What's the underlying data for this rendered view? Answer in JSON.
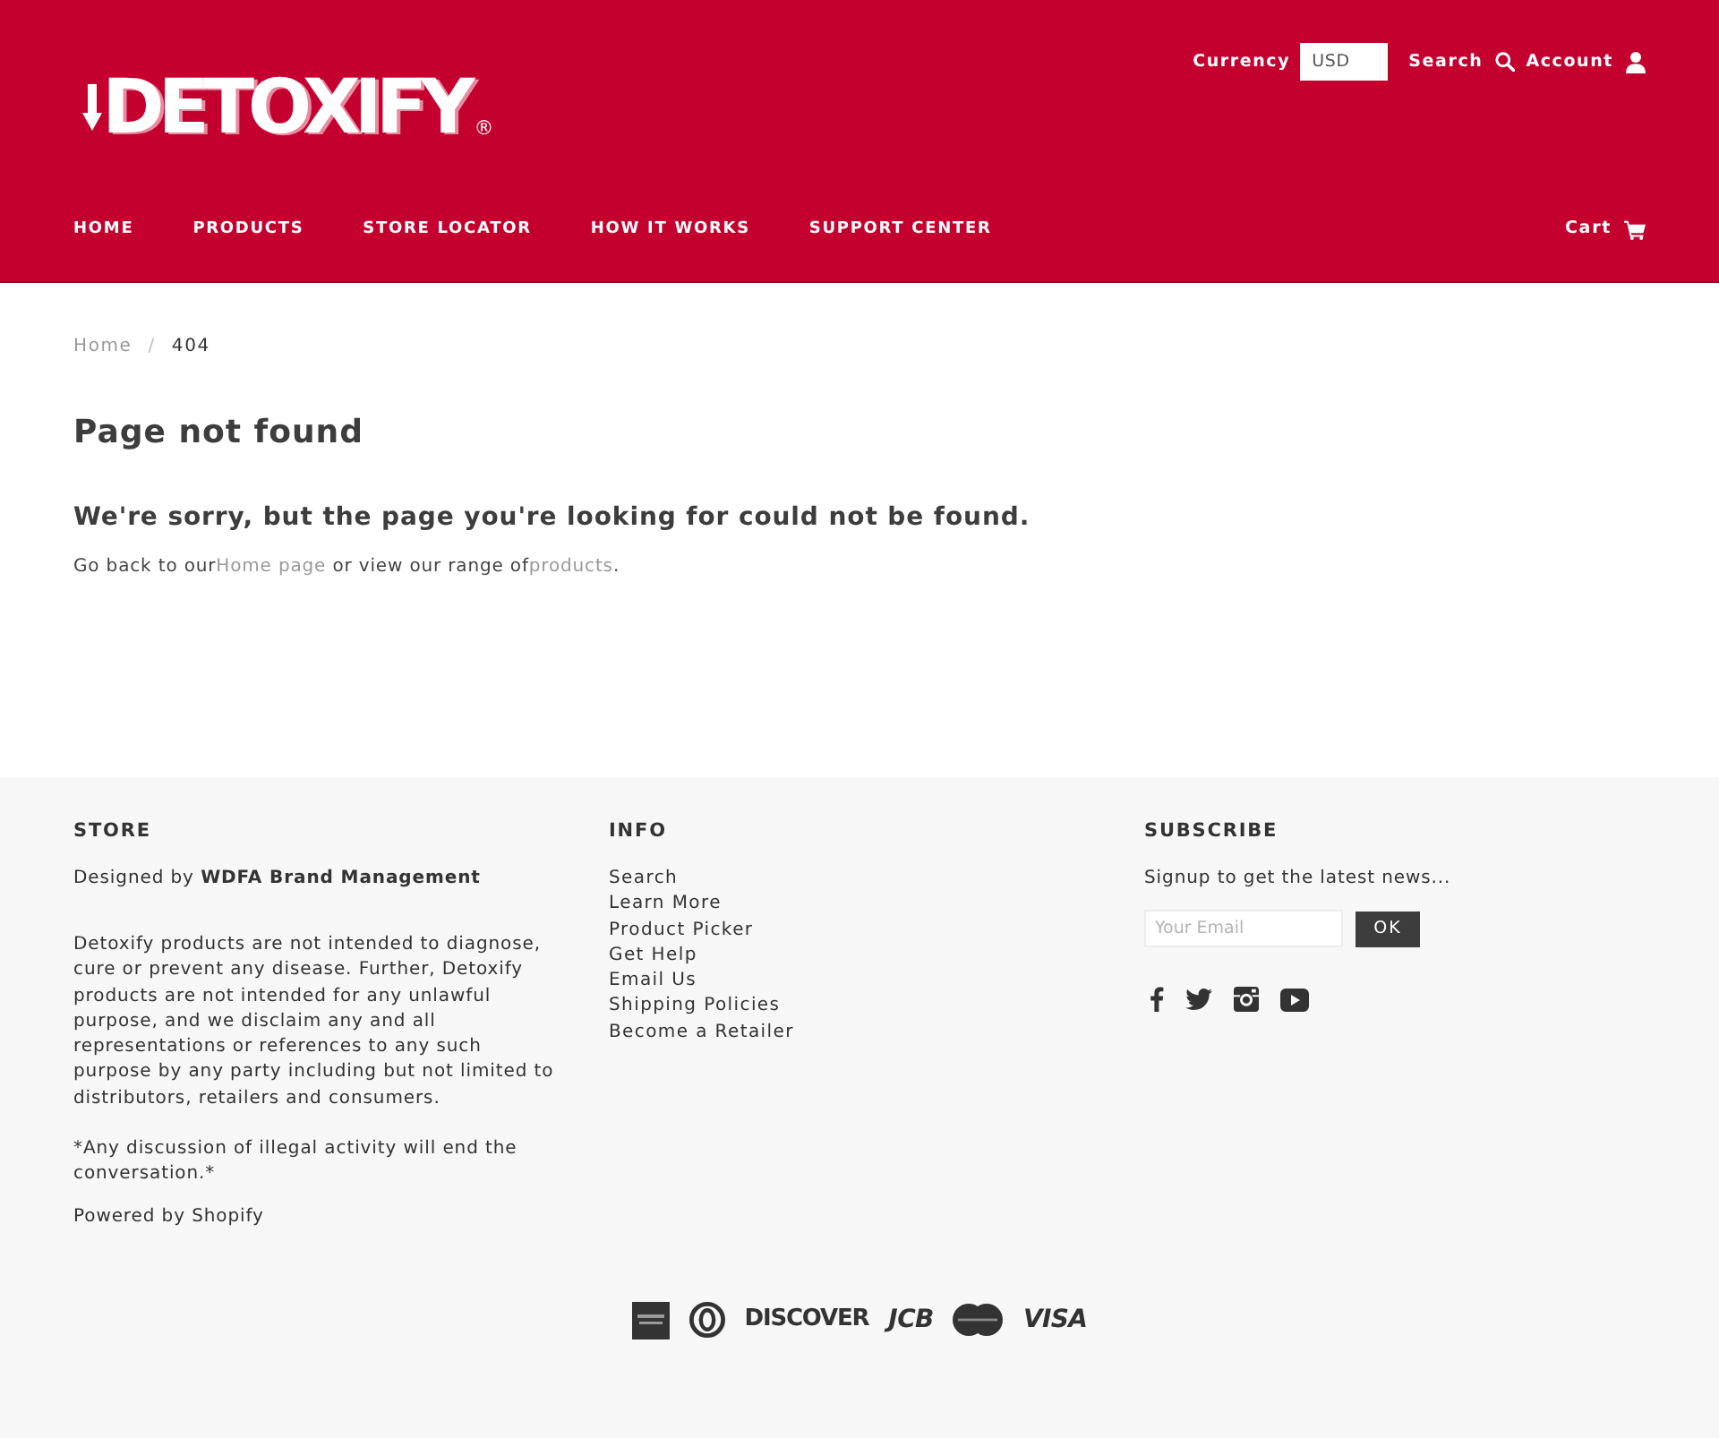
{
  "header": {
    "logo": {
      "text": "DETOXIFY",
      "mark": "®"
    },
    "currency": {
      "label": "Currency",
      "value": "USD"
    },
    "utility_links": [
      {
        "label": "Search",
        "kind": "search"
      },
      {
        "label": "Account",
        "kind": "account"
      }
    ],
    "nav": [
      "HOME",
      "PRODUCTS",
      "STORE LOCATOR",
      "HOW IT WORKS",
      "SUPPORT CENTER"
    ],
    "cart": {
      "label": "Cart"
    }
  },
  "breadcrumb": {
    "separator": "/",
    "items": [
      {
        "label": "Home",
        "current": false
      },
      {
        "label": "404",
        "current": true
      }
    ]
  },
  "page": {
    "title": "Page not found",
    "subtitle": "We're sorry, but the page you're looking for could not be found.",
    "message": [
      {
        "text": "Go back to our",
        "kind": "text"
      },
      {
        "text": "Home page",
        "kind": "link"
      },
      {
        "text": " or view our range of",
        "kind": "text"
      },
      {
        "text": "products",
        "kind": "link"
      },
      {
        "text": ".",
        "kind": "text"
      }
    ]
  },
  "footer": {
    "store": {
      "heading": "STORE",
      "credit": "Designed by **WDFA Brand Management**",
      "disclaimer": "Detoxify products are not intended to diagnose, cure or prevent any disease. Further, Detoxify products are not intended for any unlawful purpose, and we disclaim any and all representations or references to any such purpose by any party including but not limited to distributors, retailers and consumers.",
      "notice": "*Any discussion of illegal activity will end the conversation.*",
      "powered_by": "Powered by Shopify"
    },
    "info": {
      "heading": "INFO",
      "links": [
        "Search",
        "Learn More",
        "Product Picker",
        "Get Help",
        "Email Us",
        "Shipping Policies",
        "Become a Retailer"
      ]
    },
    "subscribe": {
      "heading": "SUBSCRIBE",
      "text": "Signup to get the latest news...",
      "email": {
        "placeholder": "Your Email"
      },
      "button": "OK",
      "social": [
        {
          "kind": "facebook"
        },
        {
          "kind": "twitter"
        },
        {
          "kind": "instagram"
        },
        {
          "kind": "youtube"
        }
      ]
    },
    "payment_methods": [
      {
        "kind": "tile"
      },
      {
        "kind": "ring"
      },
      {
        "kind": "wordmark",
        "text": "DISCOVER",
        "italic": false
      },
      {
        "kind": "wordmark",
        "text": "JCB",
        "italic": true
      },
      {
        "kind": "twin-circles"
      },
      {
        "kind": "wordmark",
        "text": "VISA",
        "italic": true
      }
    ]
  }
}
